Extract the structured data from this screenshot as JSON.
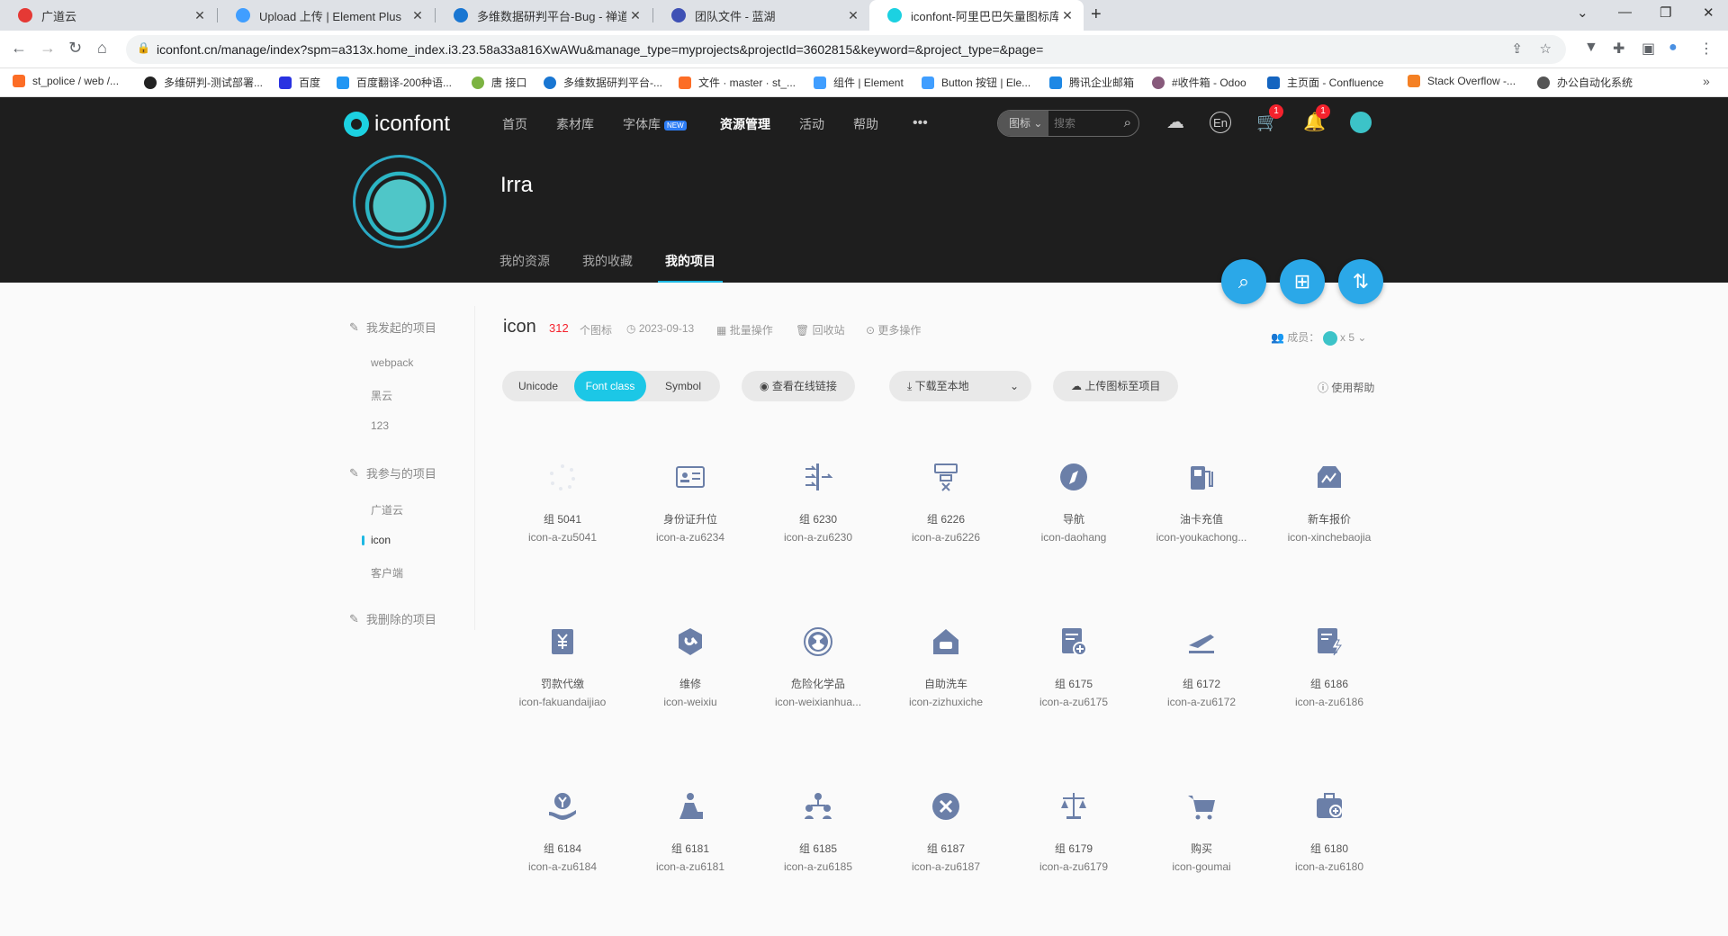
{
  "browser": {
    "tabs": [
      {
        "title": "广道云",
        "color": "#e53935"
      },
      {
        "title": "Upload 上传 | Element Plus",
        "color": "#409eff"
      },
      {
        "title": "多维数据研判平台-Bug - 禅道",
        "color": "#1976d2"
      },
      {
        "title": "团队文件 - 蓝湖",
        "color": "#3f51b5"
      },
      {
        "title": "iconfont-阿里巴巴矢量图标库",
        "color": "#1cd1e1"
      }
    ],
    "url": "iconfont.cn/manage/index?spm=a313x.home_index.i3.23.58a33a816XwAWu&manage_type=myprojects&projectId=3602815&keyword=&project_type=&page=",
    "bookmarks": [
      {
        "label": "st_police / web /...",
        "color": "#fc6d26"
      },
      {
        "label": "多维研判-测试部署...",
        "color": "#222222"
      },
      {
        "label": "百度",
        "color": "#2932e1"
      },
      {
        "label": "百度翻译-200种语...",
        "color": "#2196f3"
      },
      {
        "label": "唐 接口",
        "color": "#7cb342"
      },
      {
        "label": "多维数据研判平台-...",
        "color": "#1976d2"
      },
      {
        "label": "文件 · master · st_...",
        "color": "#fc6d26"
      },
      {
        "label": "组件 | Element",
        "color": "#409eff"
      },
      {
        "label": "Button 按钮 | Ele...",
        "color": "#409eff"
      },
      {
        "label": "腾讯企业邮箱",
        "color": "#1e88e5"
      },
      {
        "label": "#收件箱 - Odoo",
        "color": "#875a7b"
      },
      {
        "label": "主页面 - Confluence",
        "color": "#1565c0"
      },
      {
        "label": "Stack Overflow -...",
        "color": "#f48024"
      },
      {
        "label": "办公自动化系统",
        "color": "#555555"
      }
    ]
  },
  "header": {
    "logo": "iconfont",
    "nav": [
      "首页",
      "素材库",
      "字体库",
      "资源管理",
      "活动",
      "帮助",
      "•••"
    ],
    "new_badge": "NEW",
    "search_type": "图标",
    "search_placeholder": "搜索",
    "cart_count": "1",
    "bell_count": "1"
  },
  "profile": {
    "name": "Irra",
    "tabs": [
      "我的资源",
      "我的收藏",
      "我的项目"
    ]
  },
  "sidebar": {
    "initiated": {
      "label": "我发起的项目",
      "items": [
        "webpack",
        "黑云",
        "123"
      ]
    },
    "joined": {
      "label": "我参与的项目",
      "items": [
        "广道云",
        "icon",
        "客户端"
      ]
    },
    "deleted": {
      "label": "我删除的项目"
    }
  },
  "project": {
    "name": "icon",
    "count": "312",
    "count_unit": "个图标",
    "date": "2023-09-13",
    "batch": "批量操作",
    "recycle": "回收站",
    "more": "更多操作",
    "members_label": "成员：",
    "members_count": "x 5"
  },
  "toolbar": {
    "modes": [
      "Unicode",
      "Font class",
      "Symbol"
    ],
    "view_link": "查看在线链接",
    "download": "下载至本地",
    "upload": "上传图标至项目",
    "help": "使用帮助"
  },
  "icons": [
    {
      "name": "组 5041",
      "code": "icon-a-zu5041",
      "glyph": "dots"
    },
    {
      "name": "身份证升位",
      "code": "icon-a-zu6234",
      "glyph": "idcard"
    },
    {
      "name": "组 6230",
      "code": "icon-a-zu6230",
      "glyph": "arrows"
    },
    {
      "name": "组 6226",
      "code": "icon-a-zu6226",
      "glyph": "network"
    },
    {
      "name": "导航",
      "code": "icon-daohang",
      "glyph": "compass"
    },
    {
      "name": "油卡充值",
      "code": "icon-youkachong...",
      "glyph": "fuel"
    },
    {
      "name": "新车报价",
      "code": "icon-xinchebaojia",
      "glyph": "car"
    },
    {
      "name": "罚款代缴",
      "code": "icon-fakuandaijiao",
      "glyph": "yen"
    },
    {
      "name": "维修",
      "code": "icon-weixiu",
      "glyph": "wrench"
    },
    {
      "name": "危险化学品",
      "code": "icon-weixianhua...",
      "glyph": "radiation"
    },
    {
      "name": "自助洗车",
      "code": "icon-zizhuxiche",
      "glyph": "carwash"
    },
    {
      "name": "组 6175",
      "code": "icon-a-zu6175",
      "glyph": "doc-plus"
    },
    {
      "name": "组 6172",
      "code": "icon-a-zu6172",
      "glyph": "plane"
    },
    {
      "name": "组 6186",
      "code": "icon-a-zu6186",
      "glyph": "doc-bolt"
    },
    {
      "name": "组 6184",
      "code": "icon-a-zu6184",
      "glyph": "hand-coin"
    },
    {
      "name": "组 6181",
      "code": "icon-a-zu6181",
      "glyph": "worker"
    },
    {
      "name": "组 6185",
      "code": "icon-a-zu6185",
      "glyph": "team"
    },
    {
      "name": "组 6187",
      "code": "icon-a-zu6187",
      "glyph": "x-circle"
    },
    {
      "name": "组 6179",
      "code": "icon-a-zu6179",
      "glyph": "scale"
    },
    {
      "name": "购买",
      "code": "icon-goumai",
      "glyph": "cart"
    },
    {
      "name": "组 6180",
      "code": "icon-a-zu6180",
      "glyph": "medkit"
    }
  ],
  "colors": {
    "accent": "#1cc7e6",
    "icon": "#6b7fa8",
    "badge": "#f5222d",
    "fab": "#2ba8e8"
  }
}
